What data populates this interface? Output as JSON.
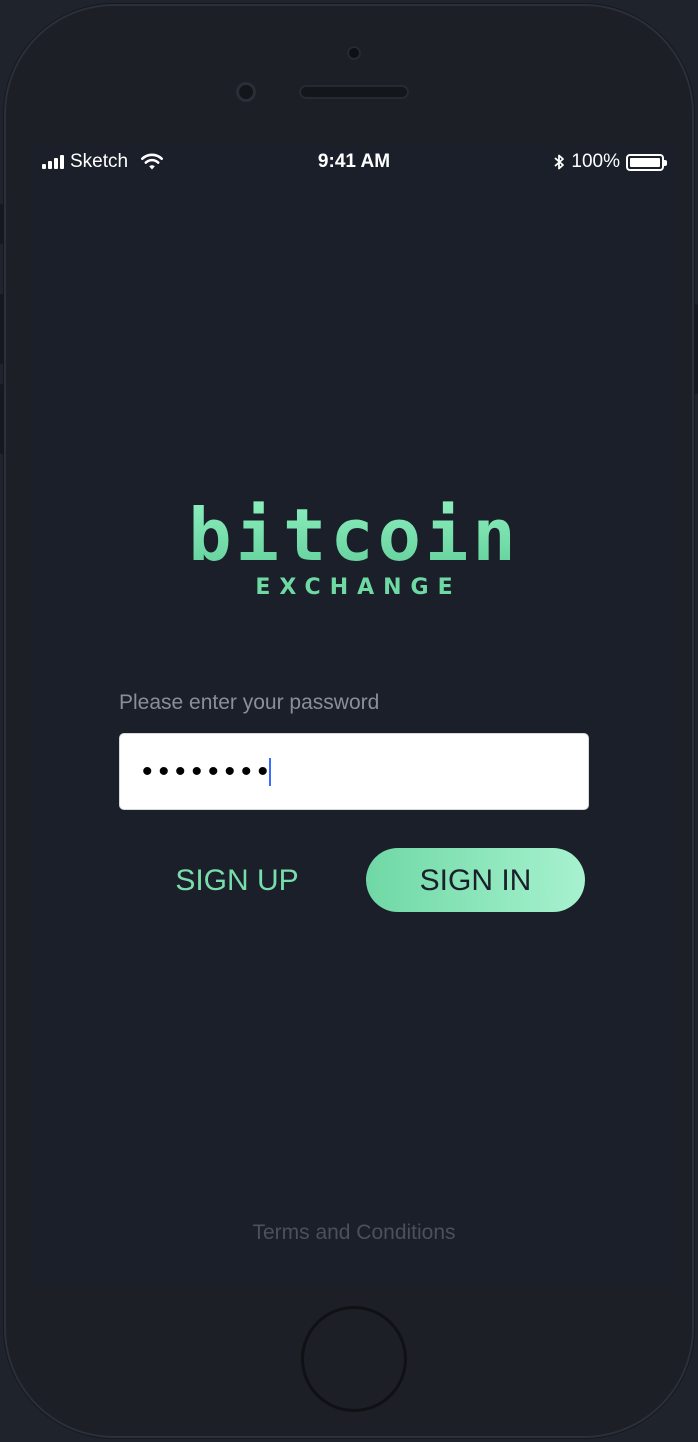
{
  "status_bar": {
    "carrier": "Sketch",
    "time": "9:41 AM",
    "battery_percent": "100%",
    "icons": [
      "signal-icon",
      "wifi-icon",
      "bluetooth-icon",
      "battery-icon"
    ]
  },
  "logo": {
    "word": "bitcoin",
    "subtitle": "EXCHANGE"
  },
  "password": {
    "label": "Please enter your password",
    "masked_value": "••••••••"
  },
  "buttons": {
    "sign_up": "SIGN UP",
    "sign_in": "SIGN IN"
  },
  "footer": {
    "terms": "Terms and Conditions"
  },
  "colors": {
    "background": "#1a1f2a",
    "accent": "#7fe0b0",
    "muted_text": "#8a8e98"
  }
}
